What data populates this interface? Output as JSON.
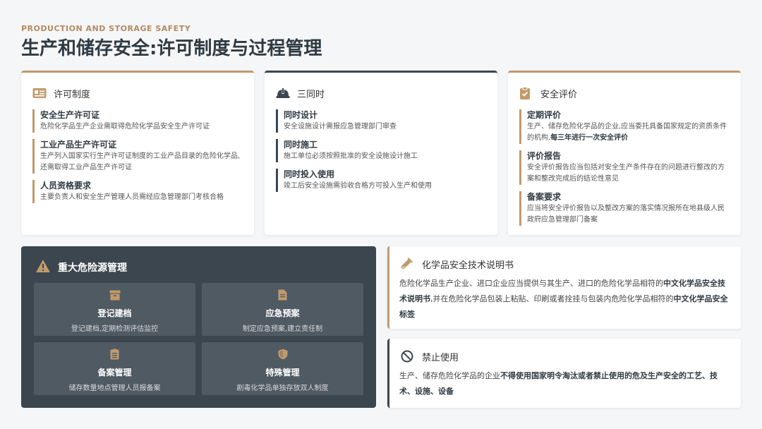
{
  "header": {
    "subtitle": "PRODUCTION AND STORAGE SAFETY",
    "title": "生产和储存安全:许可制度与过程管理"
  },
  "colors": {
    "accent": "#c19a6b",
    "dark": "#3b464f",
    "subtitle": "#b48a60"
  },
  "license": {
    "icon": "id-card-icon",
    "title": "许可制度",
    "items": [
      {
        "title": "安全生产许可证",
        "desc": "危险化学品生产企业需取得危险化学品安全生产许可证"
      },
      {
        "title": "工业产品生产许可证",
        "desc": "生产列入国家实行生产许可证制度的工业产品目录的危险化学品,还需取得工业产品生产许可证"
      },
      {
        "title": "人员资格要求",
        "desc": "主要负责人和安全生产管理人员需经应急管理部门考核合格"
      }
    ]
  },
  "three": {
    "icon": "hard-hat-icon",
    "title": "三同时",
    "items": [
      {
        "title": "同时设计",
        "desc": "安全设施设计需报应急管理部门审查"
      },
      {
        "title": "同时施工",
        "desc": "施工单位必须按照批准的安全设施设计施工"
      },
      {
        "title": "同时投入使用",
        "desc": "竣工后安全设施需验收合格方可投入生产和使用"
      }
    ]
  },
  "evaluation": {
    "icon": "clipboard-check-icon",
    "title": "安全评价",
    "items": [
      {
        "title": "定期评价",
        "desc": "生产、储存危险化学品的企业,应当委托具备国家规定的资质条件的机构,",
        "desc_bold": "每三年进行一次安全评价"
      },
      {
        "title": "评价报告",
        "desc": "安全评价报告应当包括对安全生产条件存在的问题进行整改的方案和整改完成后的结论性意见"
      },
      {
        "title": "备案要求",
        "desc": "应当将安全评价报告以及整改方案的落实情况报所在地县级人民政府应急管理部门备案"
      }
    ]
  },
  "hazard": {
    "icon": "warning-icon",
    "title": "重大危险源管理",
    "cells": [
      {
        "icon": "archive-box-icon",
        "title": "登记建档",
        "desc": "登记建档,定期检测评估监控"
      },
      {
        "icon": "document-icon",
        "title": "应急预案",
        "desc": "制定应急预案,建立责任制"
      },
      {
        "icon": "file-list-icon",
        "title": "备案管理",
        "desc": "储存数量地点管理人员报备案"
      },
      {
        "icon": "shield-icon",
        "title": "特殊管理",
        "desc": "剧毒化学品单独存放双人制度"
      }
    ]
  },
  "msds": {
    "icon": "test-tube-icon",
    "title": "化学品安全技术说明书",
    "text1": "危险化学品生产企业、进口企业应当提供与其生产、进口的危险化学品相符的",
    "bold1": "中文化学品安全技术说明书",
    "text2": ",并在危险化学品包装上粘贴、印刷或者拴挂与包装内危险化学品相符的",
    "bold2": "中文化学品安全标签"
  },
  "ban": {
    "icon": "ban-icon",
    "title": "禁止使用",
    "text1": "生产、储存危险化学品的企业",
    "bold1": "不得使用国家明令淘汰或者禁止使用的危及生产安全的工艺、技术、设施、设备"
  }
}
